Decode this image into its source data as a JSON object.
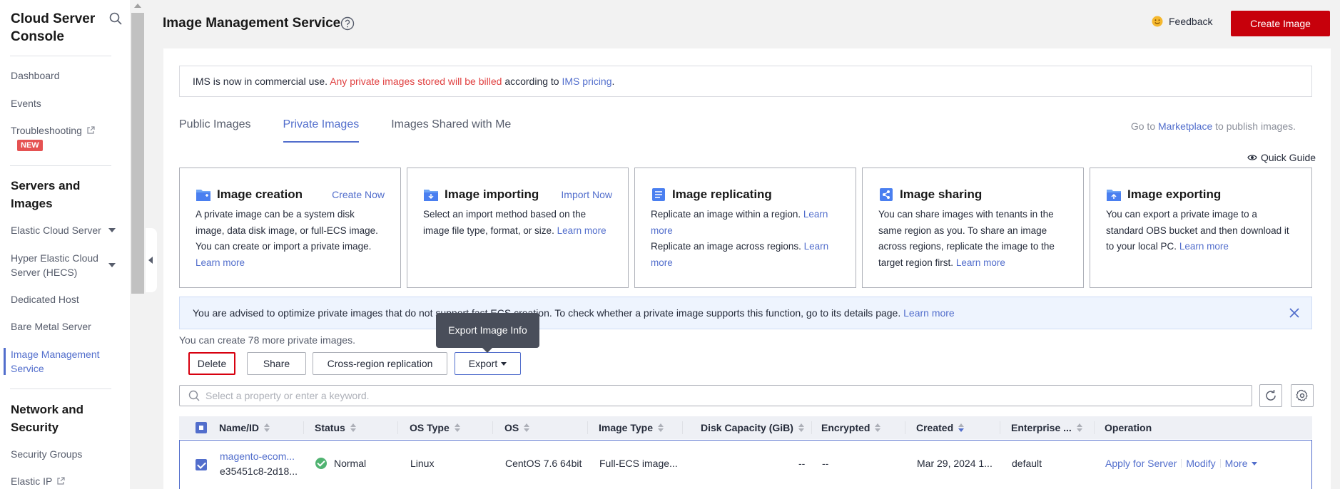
{
  "sidebar": {
    "title": "Cloud Server Console",
    "items": {
      "dashboard": "Dashboard",
      "events": "Events",
      "troubleshooting": "Troubleshooting",
      "new_badge": "NEW"
    },
    "group_servers": "Servers and Images",
    "servers_items": {
      "ecs": "Elastic Cloud Server",
      "hecs": "Hyper Elastic Cloud Server (HECS)",
      "dedicated_host": "Dedicated Host",
      "bare_metal": "Bare Metal Server",
      "ims": "Image Management Service"
    },
    "group_network": "Network and Security",
    "network_items": {
      "security_groups": "Security Groups",
      "elastic_ip": "Elastic IP"
    }
  },
  "header": {
    "title": "Image Management Service",
    "feedback": "Feedback",
    "create_image": "Create Image"
  },
  "notice": {
    "prefix": "IMS is now in commercial use.",
    "warning": "Any private images stored will be billed",
    "middle": "according to",
    "link": "IMS pricing",
    "suffix": "."
  },
  "tabs": [
    "Public Images",
    "Private Images",
    "Images Shared with Me"
  ],
  "active_tab": "Private Images",
  "marketplace": {
    "prefix": "Go to",
    "link": "Marketplace",
    "suffix": "to publish images."
  },
  "quick_guide": "Quick Guide",
  "feature_cards": [
    {
      "title": "Image creation",
      "action": "Create Now",
      "body": "A private image can be a system disk image, data disk image, or full-ECS image. You can create or import a private image.",
      "link": "Learn more",
      "icon": "image-creation-icon"
    },
    {
      "title": "Image importing",
      "action": "Import Now",
      "body": "Select an import method based on the image file type, format, or size.",
      "link": "Learn more",
      "icon": "image-importing-icon"
    },
    {
      "title": "Image replicating",
      "action": "",
      "body": "Replicate an image within a region.",
      "link": "Learn more",
      "body2": "Replicate an image across regions.",
      "link2": "Learn more",
      "icon": "image-replicating-icon"
    },
    {
      "title": "Image sharing",
      "action": "",
      "body": "You can share images with tenants in the same region as you. To share an image across regions, replicate the image to the target region first.",
      "link": "Learn more",
      "icon": "image-sharing-icon"
    },
    {
      "title": "Image exporting",
      "action": "",
      "body": "You can export a private image to a standard OBS bucket and then download it to your local PC.",
      "link": "Learn more",
      "icon": "image-exporting-icon"
    }
  ],
  "infobar": {
    "text": "You are advised to optimize private images that do not support fast ECS creation. To check whether a private image supports this function, go to its details page.",
    "link": "Learn more"
  },
  "quota": "You can create 78 more private images.",
  "tooltip": "Export Image Info",
  "toolbar": {
    "delete": "Delete",
    "share": "Share",
    "cross_region": "Cross-region replication",
    "export": "Export"
  },
  "search": {
    "placeholder": "Select a property or enter a keyword."
  },
  "table": {
    "columns": [
      "Name/ID",
      "Status",
      "OS Type",
      "OS",
      "Image Type",
      "Disk Capacity (GiB)",
      "Encrypted",
      "Created",
      "Enterprise ...",
      "Operation"
    ],
    "rows": [
      {
        "name": "magento-ecom...",
        "id": "e35451c8-2d18...",
        "status": "Normal",
        "os_type": "Linux",
        "os": "CentOS 7.6 64bit",
        "image_type": "Full-ECS image...",
        "disk_capacity": "--",
        "encrypted": "--",
        "created": "Mar 29, 2024 1...",
        "enterprise_project": "default",
        "op_apply": "Apply for Server",
        "op_modify": "Modify",
        "op_more": "More"
      }
    ]
  },
  "colors": {
    "accent": "#526ecc",
    "brand": "#c7000b",
    "danger": "#e04040"
  }
}
